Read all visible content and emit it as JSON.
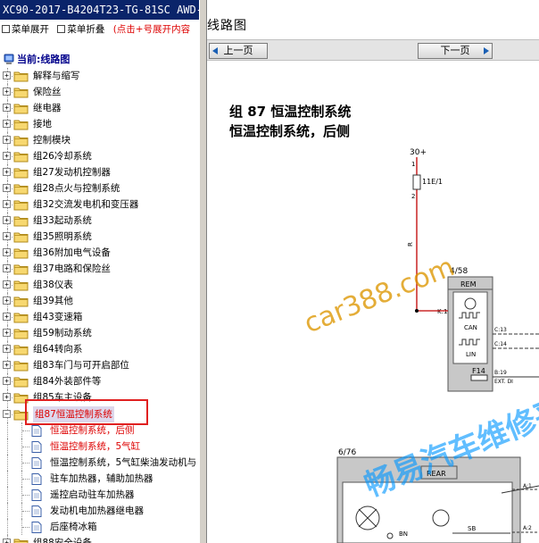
{
  "window": {
    "title": "XC90-2017-B4204T23-TG-81SC AWD-"
  },
  "toolbar": {
    "expand_label": "菜单展开",
    "collapse_label": "菜单折叠",
    "hint": "(点击+号展开内容"
  },
  "tree": {
    "current_label": "当前:线路图",
    "items": [
      {
        "label": "解释与缩写"
      },
      {
        "label": "保险丝"
      },
      {
        "label": "继电器"
      },
      {
        "label": "接地"
      },
      {
        "label": "控制模块"
      },
      {
        "label": "组26冷却系统"
      },
      {
        "label": "组27发动机控制器"
      },
      {
        "label": "组28点火与控制系统"
      },
      {
        "label": "组32交流发电机和变压器"
      },
      {
        "label": "组33起动系统"
      },
      {
        "label": "组35照明系统"
      },
      {
        "label": "组36附加电气设备"
      },
      {
        "label": "组37电路和保险丝"
      },
      {
        "label": "组38仪表"
      },
      {
        "label": "组39其他"
      },
      {
        "label": "组43变速箱"
      },
      {
        "label": "组59制动系统"
      },
      {
        "label": "组64转向系"
      },
      {
        "label": "组83车门与可开启部位"
      },
      {
        "label": "组84外装部件等"
      },
      {
        "label": "组85车主设备"
      }
    ],
    "selected": {
      "label": "组87恒温控制系统"
    },
    "children": [
      {
        "label": "恒温控制系统，后侧",
        "highlight": true
      },
      {
        "label": "恒温控制系统，5气缸",
        "highlight": true
      },
      {
        "label": "恒温控制系统，5气缸柴油发动机与",
        "highlight": false
      },
      {
        "label": "驻车加热器，辅助加热器",
        "highlight": false
      },
      {
        "label": "遥控启动驻车加热器",
        "highlight": false
      },
      {
        "label": "发动机电加热器继电器",
        "highlight": false
      },
      {
        "label": "后座椅冰箱",
        "highlight": false
      }
    ],
    "last_item": {
      "label": "组88安全设备"
    }
  },
  "viewer": {
    "title": "线路图",
    "prev_label": "上一页",
    "next_label": "下一页",
    "doc_title_line1": "组 87 恒温控制系统",
    "doc_title_line2": "恒温控制系统，后侧",
    "diagram": {
      "supply": "30+",
      "fuse": "11E/1",
      "wire_color": "R",
      "conn_1": "4/58",
      "module_1": "REM",
      "pin_k1": "K:1",
      "can": "CAN",
      "lin": "LIN",
      "pin_c13": "C:13",
      "pin_c14": "C:14",
      "f14": "F14",
      "pin_b19": "B:19",
      "ext": "EXT. DI",
      "conn_2": "6/76",
      "module_2": "REAR",
      "pin_a1": "A:1",
      "pin_a2": "A:2",
      "bn": "BN",
      "sb": "SB"
    },
    "watermark_1": "car388.com",
    "watermark_2": "畅易汽车维修平"
  }
}
